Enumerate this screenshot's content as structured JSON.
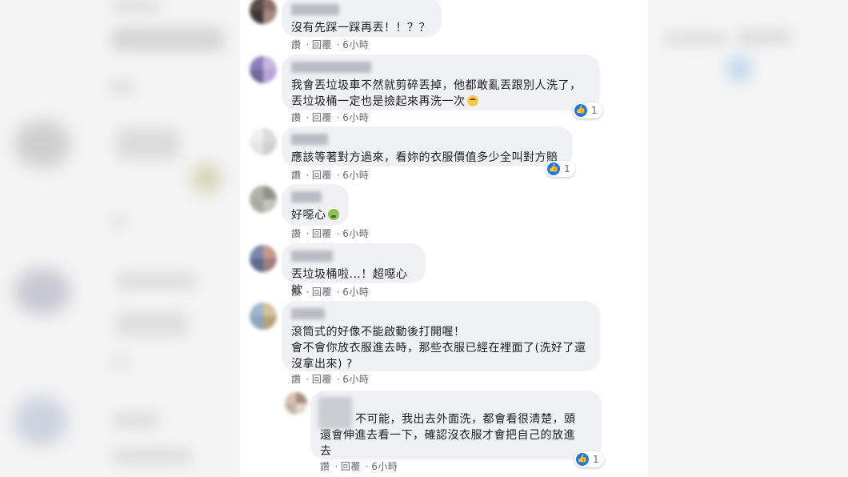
{
  "comments": [
    {
      "text": "沒有先踩一踩再丟！！？？",
      "meta": {
        "like": "讚",
        "reply": "回覆",
        "time": "6小時"
      }
    },
    {
      "text": "我會丟垃圾車不然就剪碎丟掉，他都敢亂丟跟別人洗了，\n丟垃圾桶一定也是撿起來再洗一次",
      "emoji": "rolling-eyes",
      "reaction_count": "1",
      "meta": {
        "like": "讚",
        "reply": "回覆",
        "time": "6小時"
      }
    },
    {
      "text": "應該等著對方過來，看妳的衣服價值多少全叫對方賠",
      "reaction_count": "1",
      "meta": {
        "like": "讚",
        "reply": "回覆",
        "time": "6小時"
      }
    },
    {
      "text": "好噁心",
      "emoji": "nauseated-face",
      "meta": {
        "like": "讚",
        "reply": "回覆",
        "time": "6小時"
      }
    },
    {
      "text": "丟垃圾桶啦...！超噁心欸",
      "meta": {
        "like": "讚",
        "reply": "回覆",
        "time": "6小時"
      }
    },
    {
      "text": "滾筒式的好像不能啟動後打開喔！\n會不會你放衣服進去時，那些衣服已經在裡面了(洗好了還\n沒拿出來) ?",
      "meta": {
        "like": "讚",
        "reply": "回覆",
        "time": "6小時"
      }
    },
    {
      "text": "不可能，我出去外面洗，都會看很清楚，頭\n還會伸進去看一下，確認沒衣服才會把自己的放進\n去",
      "reaction_count": "1",
      "meta": {
        "like": "讚",
        "reply": "回覆",
        "time": "6小時"
      }
    }
  ],
  "colors": {
    "bubble": "#eff1f4",
    "like_blue": "#1877f2",
    "meta_gray": "#65676b",
    "text": "#1c1e21"
  },
  "icons": {
    "like": "thumbs-up-icon"
  }
}
